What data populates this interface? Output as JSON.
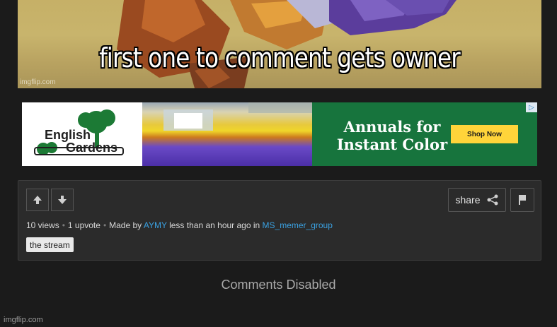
{
  "meme": {
    "caption": "first one to comment gets owner",
    "watermark": "imgflip.com"
  },
  "ad": {
    "brand_line1": "English",
    "brand_line2": "Gardens",
    "headline": "Annuals for Instant Color",
    "cta": "Shop Now",
    "choices_icon": "ad-choices-icon",
    "green": "#17743d",
    "cta_color": "#ffd43a"
  },
  "panel": {
    "share_label": "share",
    "icons": {
      "upvote": "arrow-up-icon",
      "downvote": "arrow-down-icon",
      "share": "share-icon",
      "flag": "flag-icon"
    },
    "meta": {
      "views": "10 views",
      "upvotes": "1 upvote",
      "made_by_prefix": "Made by",
      "author": "AYMY",
      "time_text": "less than an hour ago in",
      "stream": "MS_memer_group"
    },
    "tag": "the stream",
    "link_color": "#3aa0e0"
  },
  "comments_status": "Comments Disabled",
  "footer_watermark": "imgflip.com"
}
